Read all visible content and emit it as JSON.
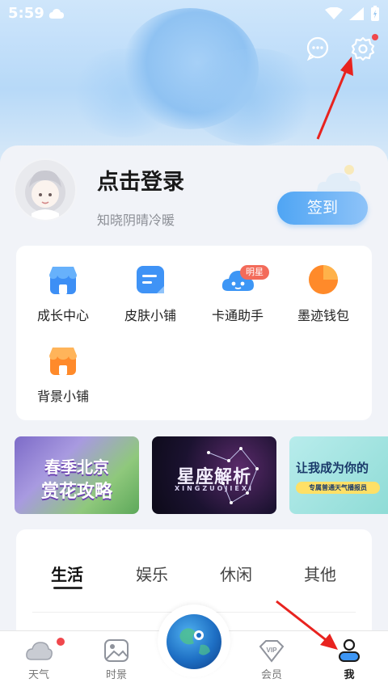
{
  "status": {
    "time": "5:59"
  },
  "profile": {
    "login_title": "点击登录",
    "subtitle": "知晓阴晴冷暖",
    "signin_button": "签到"
  },
  "services": [
    {
      "label": "成长中心",
      "icon": "store-icon"
    },
    {
      "label": "皮肤小铺",
      "icon": "document-icon"
    },
    {
      "label": "卡通助手",
      "icon": "cartoon-cloud-icon",
      "badge": "明星"
    },
    {
      "label": "墨迹钱包",
      "icon": "pie-wallet-icon"
    },
    {
      "label": "背景小铺",
      "icon": "orange-store-icon"
    }
  ],
  "banners": [
    {
      "line1": "春季北京",
      "line2": "赏花攻略"
    },
    {
      "line1": "星座解析",
      "line2": "XINGZUOJIEXI"
    },
    {
      "line1": "让我成为你的",
      "line2": "专属普通天气播报员"
    }
  ],
  "categories": {
    "tabs": [
      "生活",
      "娱乐",
      "休闲",
      "其他"
    ],
    "active": "生活"
  },
  "bottom_nav": [
    {
      "label": "天气",
      "icon": "cloud-icon"
    },
    {
      "label": "时景",
      "icon": "image-icon"
    },
    {
      "label": "会员",
      "icon": "vip-icon"
    },
    {
      "label": "我",
      "icon": "person-icon"
    }
  ],
  "colors": {
    "accent": "#4fa5f4",
    "badge_red": "#f0474c",
    "arrow_red": "#e8231f"
  }
}
